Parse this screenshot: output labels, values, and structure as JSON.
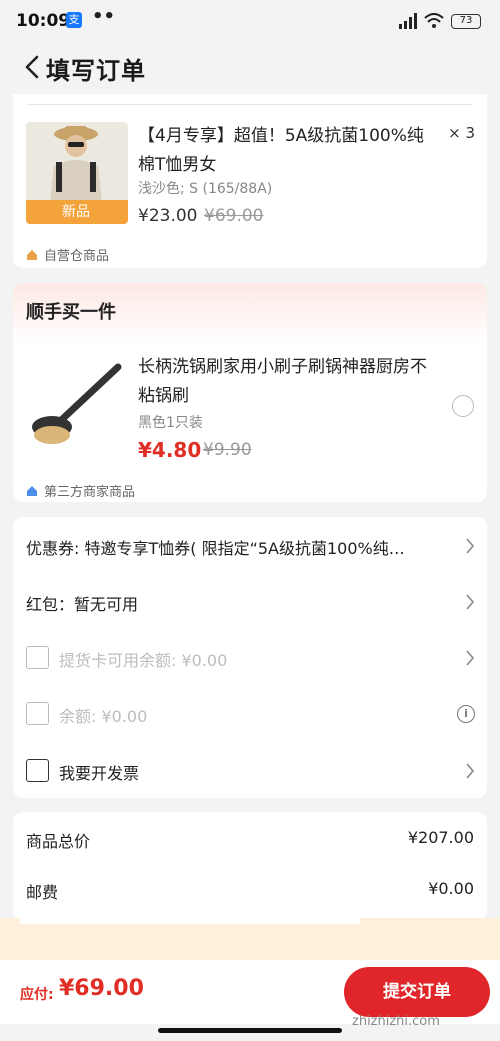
{
  "status": {
    "time": "10:09",
    "alipay": "支",
    "dots": "••",
    "battery": "73"
  },
  "header": {
    "title": "填写订单"
  },
  "product": {
    "title": "【4月专享】超值！5A级抗菌100%纯棉T恤男女",
    "qty": "× 3",
    "spec": "浅沙色; S (165/88A)",
    "price": "¥23.00",
    "orig_price": "¥69.00",
    "tag": "新品",
    "store": "自营仓商品"
  },
  "addon": {
    "heading": "顺手买一件",
    "title": "长柄洗锅刷家用小刷子刷锅神器厨房不粘锅刷",
    "spec": "黑色1只装",
    "price": "¥4.80",
    "orig_price": "¥9.90",
    "store": "第三方商家商品"
  },
  "options": {
    "coupon": "优惠券: 特邀专享T恤券( 限指定“5A级抗菌100%纯…",
    "redpacket": "红包：暂无可用",
    "card_balance": "提货卡可用余额: ¥0.00",
    "balance": "余额: ¥0.00",
    "invoice": "我要开发票"
  },
  "summary": {
    "total_label": "商品总价",
    "total_value": "¥207.00",
    "shipping_label": "邮费",
    "shipping_value": "¥0.00"
  },
  "bottom": {
    "pay_label": "应付:",
    "pay_amount": "¥69.00",
    "submit": "提交订单"
  },
  "watermark": "zhizhizhi.com"
}
